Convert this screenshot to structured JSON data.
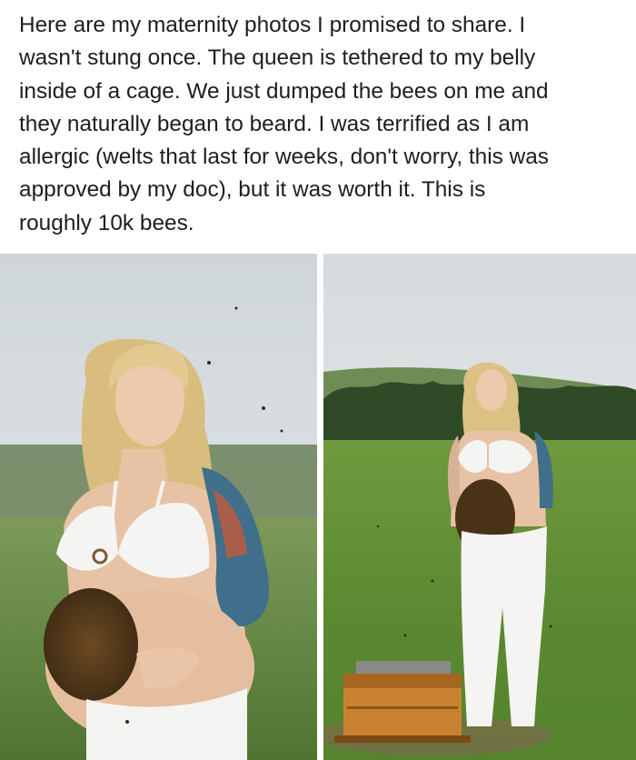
{
  "post": {
    "text_lines": [
      "Here are my maternity photos I promised to share. I",
      "wasn't stung once. The queen is tethered to my belly",
      "inside of a cage. We just dumped the bees on me and",
      "they naturally began to beard. I was terrified as I am",
      "allergic (welts that last for weeks, don't worry, this was",
      "approved by my doc), but it was worth it. This is",
      "roughly 10k bees."
    ]
  },
  "photos": [
    {
      "subject": "woman-close-up-with-bee-swarm-on-belly"
    },
    {
      "subject": "woman-full-body-in-field-with-beehive-box"
    }
  ],
  "colors": {
    "text": "#1c1e21",
    "background": "#ffffff",
    "sky": "#dfe3e6",
    "grass": "#5f8a3a",
    "trees": "#2f4a26",
    "bikini": "#f4f4f2",
    "bees": "#5a3e1e",
    "hive": "#c9822f"
  }
}
